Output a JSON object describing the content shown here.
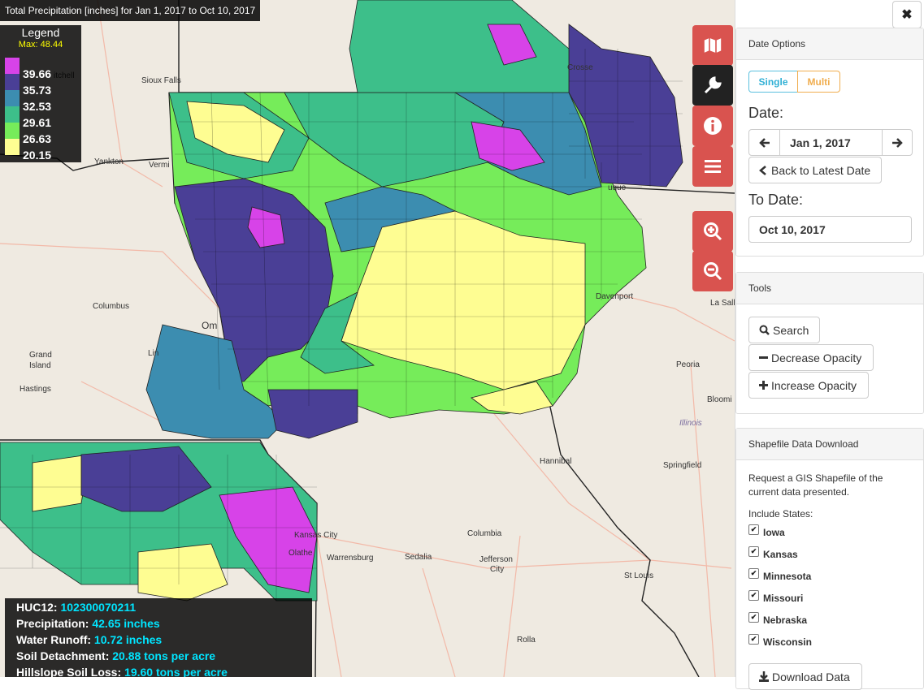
{
  "map": {
    "title": "Total Precipitation [inches] for Jan 1, 2017 to Oct 10, 2017",
    "legend": {
      "title": "Legend",
      "max_label": "Max: 48.44",
      "entries": [
        {
          "label": "39.66",
          "color": "#d743e8"
        },
        {
          "label": "35.73",
          "color": "#4a3f96"
        },
        {
          "label": "32.53",
          "color": "#3c8db0"
        },
        {
          "label": "29.61",
          "color": "#3dbf8a"
        },
        {
          "label": "26.63",
          "color": "#76ec5a"
        },
        {
          "label": "20.15",
          "color": "#fefd92"
        }
      ]
    },
    "places": {
      "sioux_falls": "Sioux Falls",
      "yankton": "Yankton",
      "columbus": "Columbus",
      "grand": "Grand",
      "island": "Island",
      "hastings": "Hastings",
      "om": "Om",
      "lin": "Lin",
      "crosse": "Crosse",
      "davenport": "Davenport",
      "la_salle": "La Salle",
      "peoria": "Peoria",
      "bloomi": "Bloomi",
      "illinois": "Illinois",
      "hannibal": "Hannibal",
      "springfield": "Springfield",
      "kansas_city": "Kansas City",
      "olathe": "Olathe",
      "warrensburg": "Warrensburg",
      "sedalia": "Sedalia",
      "columbia": "Columbia",
      "jefferson": "Jefferson",
      "city": "City",
      "st_louis": "St Louis",
      "rolla": "Rolla",
      "itchell": "itchell",
      "vermi": "Vermi",
      "uque": "uque",
      "sid": "Sio"
    },
    "info": {
      "huc12_label": "HUC12:",
      "huc12": "102300070211",
      "precip_label": "Precipitation:",
      "precip": "42.65 inches",
      "runoff_label": "Water Runoff:",
      "runoff": "10.72 inches",
      "detach_label": "Soil Detachment:",
      "detach": "20.88 tons per acre",
      "loss_label": "Hillslope Soil Loss:",
      "loss": "19.60 tons per acre"
    },
    "toolbar_icons": [
      "map-icon",
      "wrench-icon",
      "info-icon",
      "bars-icon",
      "zoom-in-icon",
      "zoom-out-icon"
    ]
  },
  "sidebar": {
    "close_symbol": "✖",
    "date_options": {
      "heading": "Date Options",
      "single_label": "Single",
      "multi_label": "Multi",
      "date_label": "Date:",
      "date_value": "Jan 1, 2017",
      "back_label": "Back to Latest Date",
      "to_date_label": "To Date:",
      "to_date_value": "Oct 10, 2017"
    },
    "tools": {
      "heading": "Tools",
      "search_label": "Search",
      "decrease_label": "Decrease Opacity",
      "increase_label": "Increase Opacity"
    },
    "shapefile": {
      "heading": "Shapefile Data Download",
      "description": "Request a GIS Shapefile of the current data presented.",
      "include_label": "Include States:",
      "states": [
        "Iowa",
        "Kansas",
        "Minnesota",
        "Missouri",
        "Nebraska",
        "Wisconsin"
      ],
      "download_label": "Download Data"
    }
  }
}
